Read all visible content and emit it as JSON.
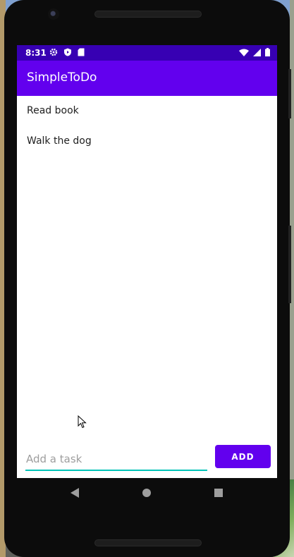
{
  "status_bar": {
    "time": "8:31",
    "left_icons": [
      "gear-icon",
      "shield-icon",
      "sd-card-icon"
    ],
    "right_icons": [
      "wifi-icon",
      "signal-icon",
      "battery-icon"
    ]
  },
  "app_bar": {
    "title": "SimpleToDo",
    "color": "#6200ee",
    "status_color": "#3700b3"
  },
  "tasks": [
    {
      "label": "Read book"
    },
    {
      "label": "Walk the dog"
    }
  ],
  "input": {
    "placeholder": "Add a task",
    "value": "",
    "underline_color": "#03c4b8"
  },
  "add_button": {
    "label": "ADD"
  },
  "nav_bar": {
    "icons": [
      "back-icon",
      "home-icon",
      "recents-icon"
    ]
  }
}
